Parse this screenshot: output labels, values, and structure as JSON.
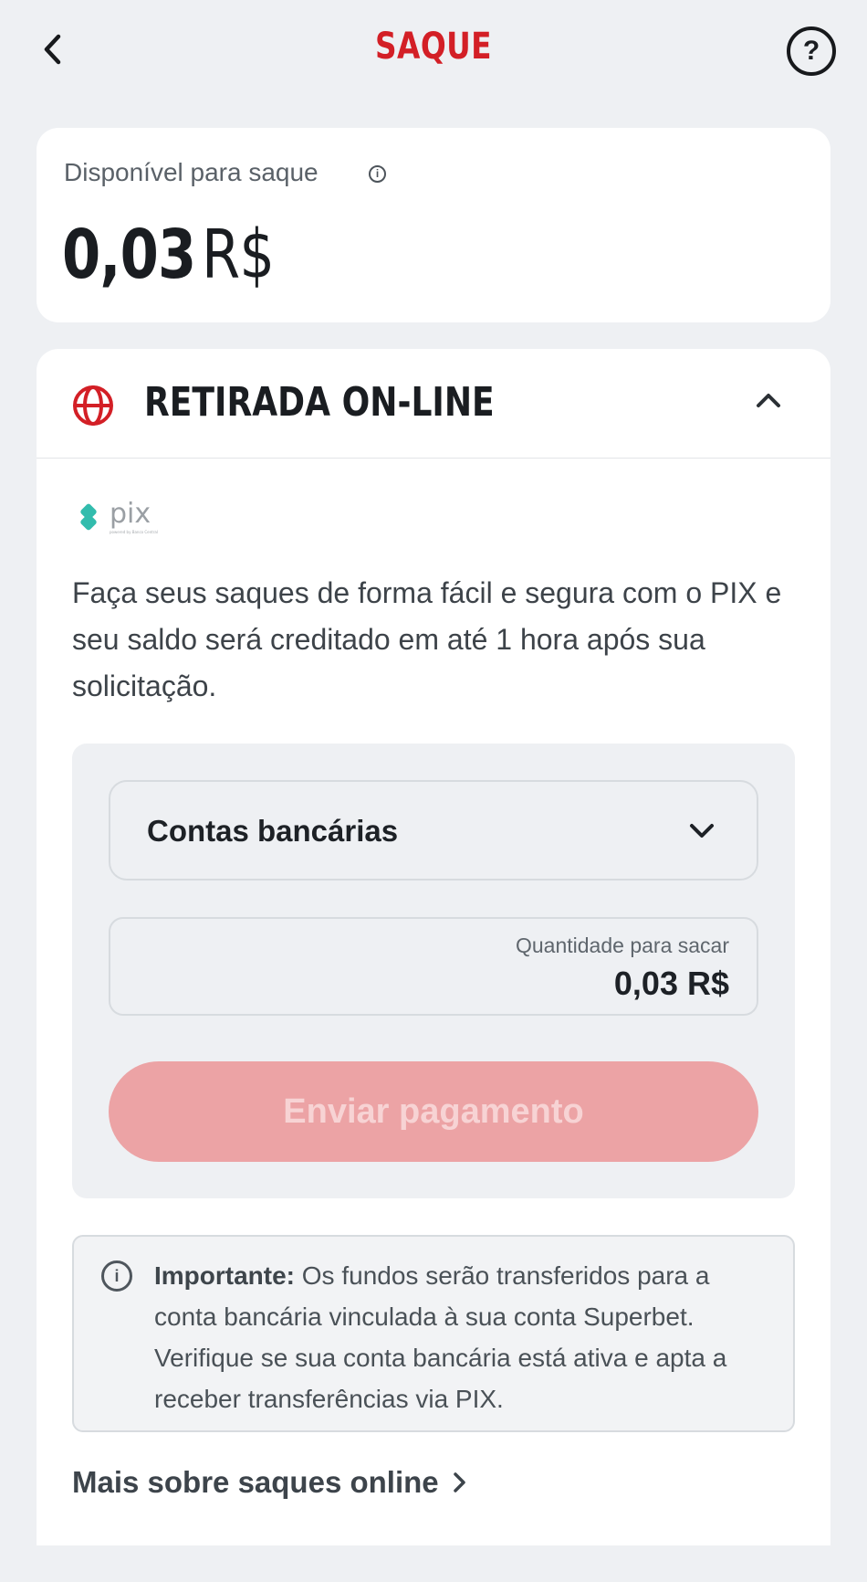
{
  "header": {
    "title": "SAQUE",
    "title_color": "#d31f26"
  },
  "balance": {
    "label": "Disponível para saque",
    "amount": "0,03",
    "currency": "R$"
  },
  "withdraw_section": {
    "title": "RETIRADA ON-LINE",
    "accent_color": "#d31f26",
    "logo_text": "pix",
    "logo_subtext": "powered by Banco Central",
    "description": "Faça seus saques de forma fácil e segura com o PIX e seu saldo será creditado em até 1 hora após sua solicitação.",
    "account_select": {
      "value": "Contas bancárias"
    },
    "amount_field": {
      "label": "Quantidade para sacar",
      "value": "0,03 R$"
    },
    "submit_button": {
      "label": "Enviar pagamento",
      "state": "disabled"
    },
    "notice": {
      "title": "Importante:",
      "body": "Os fundos serão transferidos para a conta bancária vinculada à sua conta Superbet. Verifique se sua conta bancária está ativa e apta a receber transferências via PIX."
    },
    "more_link": "Mais sobre saques online"
  },
  "icons": {
    "back": "chevron-left-icon",
    "help": "question-circle-icon",
    "info": "info-icon",
    "globe": "globe-icon",
    "collapse": "chevron-up-icon",
    "dropdown": "chevron-down-icon",
    "link_arrow": "chevron-right-icon"
  }
}
